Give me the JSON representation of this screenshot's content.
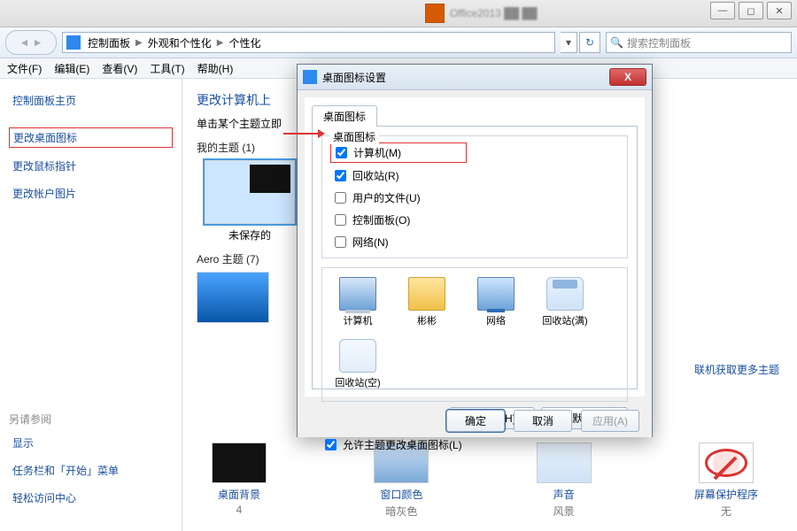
{
  "titlebar": {
    "bg_text": "Office2013 ██ ██",
    "min": "—",
    "max": "◻",
    "close": "✕"
  },
  "address": {
    "crumb1": "控制面板",
    "crumb2": "外观和个性化",
    "crumb3": "个性化",
    "search_placeholder": "搜索控制面板"
  },
  "menus": [
    "文件(F)",
    "编辑(E)",
    "查看(V)",
    "工具(T)",
    "帮助(H)"
  ],
  "sidebar": {
    "home": "控制面板主页",
    "links": [
      "更改桌面图标",
      "更改鼠标指针",
      "更改帐户图片"
    ],
    "see_also_hdr": "另请参阅",
    "see_also": [
      "显示",
      "任务栏和「开始」菜单",
      "轻松访问中心"
    ]
  },
  "main": {
    "heading": "更改计算机上",
    "subtitle": "单击某个主题立即",
    "my_themes": "我的主题 (1)",
    "thumb_unsaved": "未保存的",
    "aero_themes": "Aero 主题 (7)",
    "link_more": "联机获取更多主题"
  },
  "bottom": [
    {
      "label": "桌面背景",
      "value": "4"
    },
    {
      "label": "窗口颜色",
      "value": "暗灰色"
    },
    {
      "label": "声音",
      "value": "风景"
    },
    {
      "label": "屏幕保护程序",
      "value": "无"
    }
  ],
  "dialog": {
    "title": "桌面图标设置",
    "tab": "桌面图标",
    "fieldset_legend": "桌面图标",
    "chk_computer": "计算机(M)",
    "chk_recycle": "回收站(R)",
    "chk_userfiles": "用户的文件(U)",
    "chk_cpanel": "控制面板(O)",
    "chk_network": "网络(N)",
    "icons": [
      "计算机",
      "彬彬",
      "网络",
      "回收站(满)",
      "回收站(空)"
    ],
    "change_icon": "更改图标(H)...",
    "restore": "还原默认值(S)",
    "allow_themes": "允许主题更改桌面图标(L)",
    "ok": "确定",
    "cancel": "取消",
    "apply": "应用(A)"
  }
}
